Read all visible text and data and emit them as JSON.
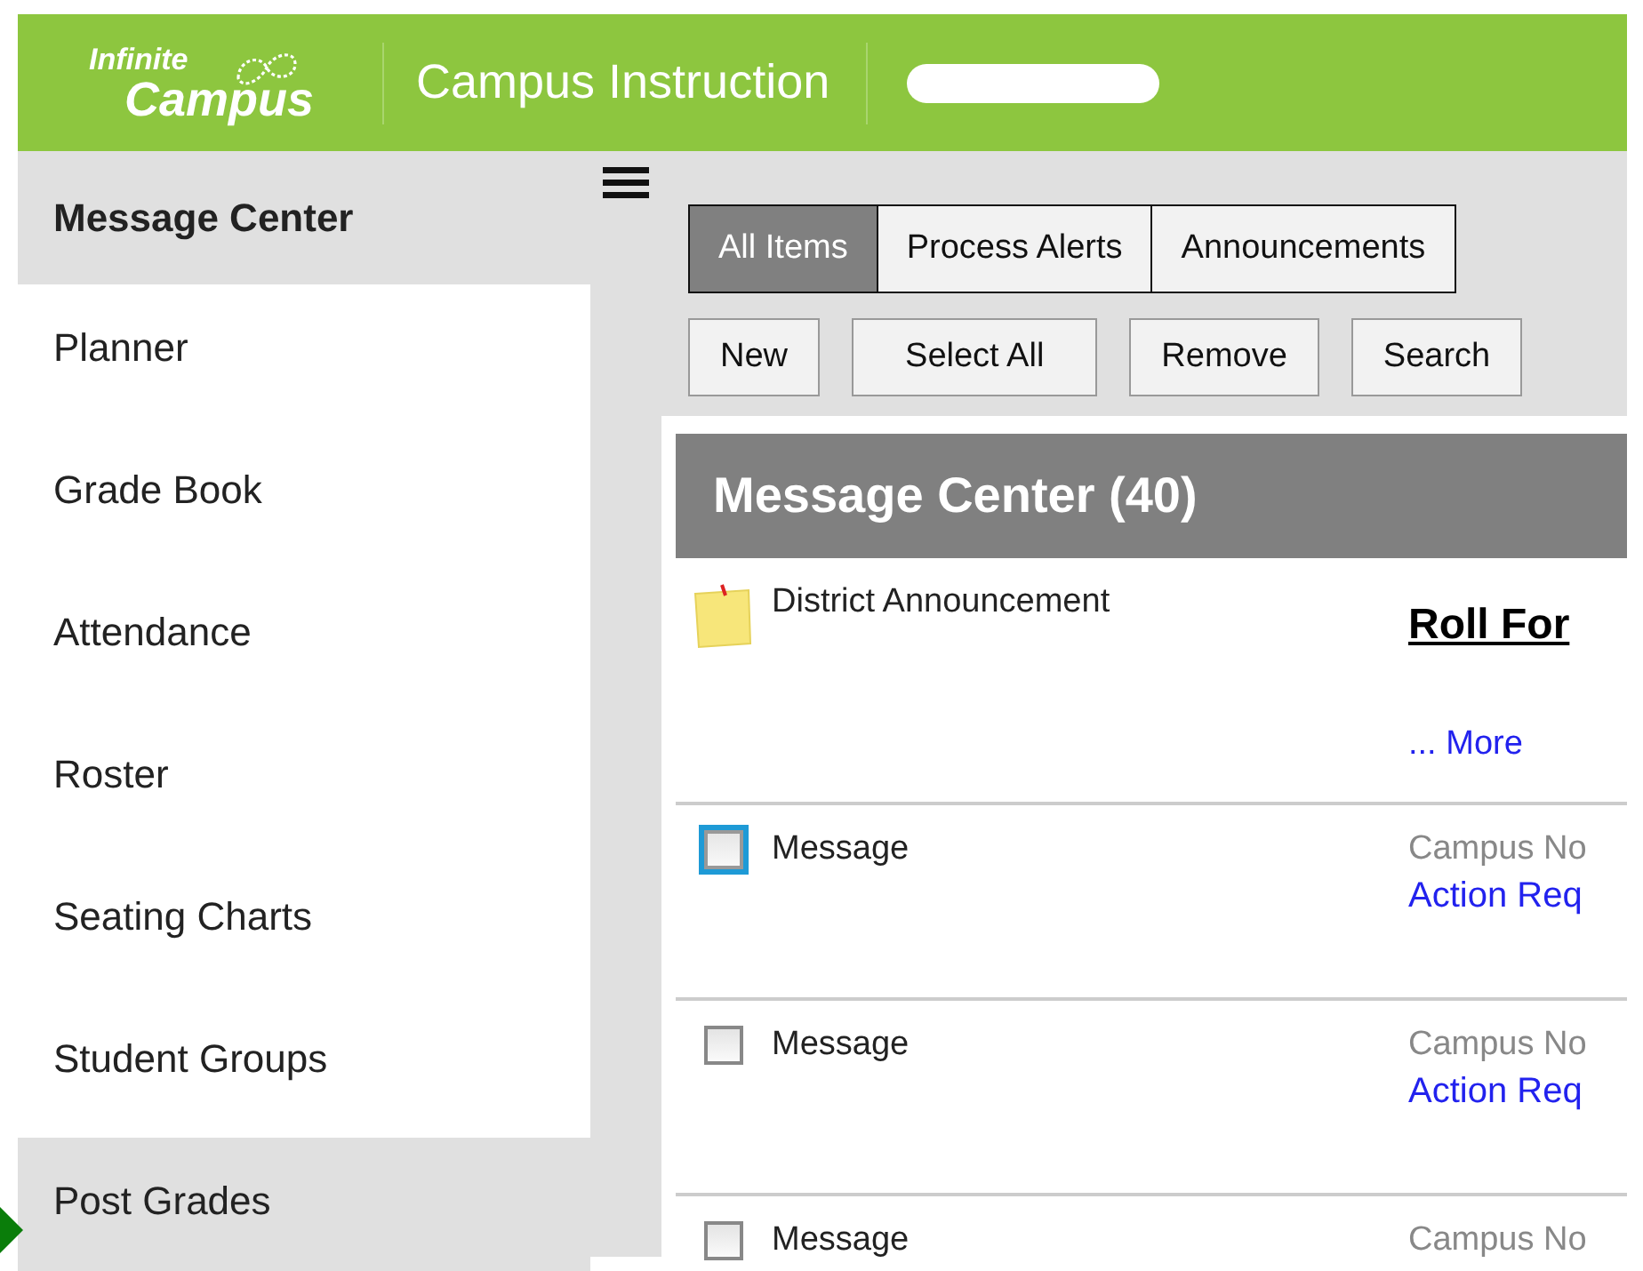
{
  "header": {
    "logo_top": "Infinite",
    "logo_bottom": "Campus",
    "app_title": "Campus Instruction"
  },
  "sidebar": {
    "title": "Message Center",
    "items": [
      {
        "label": "Planner",
        "selected": false
      },
      {
        "label": "Grade Book",
        "selected": false
      },
      {
        "label": "Attendance",
        "selected": false
      },
      {
        "label": "Roster",
        "selected": false
      },
      {
        "label": "Seating Charts",
        "selected": false
      },
      {
        "label": "Student Groups",
        "selected": false
      },
      {
        "label": "Post Grades",
        "selected": true
      }
    ]
  },
  "tabs": [
    {
      "label": "All Items",
      "selected": true
    },
    {
      "label": "Process Alerts",
      "selected": false
    },
    {
      "label": "Announcements",
      "selected": false
    }
  ],
  "buttons": [
    "New",
    "Select All",
    "Remove",
    "Search"
  ],
  "panel": {
    "title": "Message Center (40)",
    "rows": [
      {
        "kind": "announcement",
        "type": "District Announcement",
        "title": "Roll For",
        "more": "... More"
      },
      {
        "kind": "message",
        "type": "Message",
        "checked": false,
        "focused": true,
        "from": "Campus No",
        "action": "Action Req"
      },
      {
        "kind": "message",
        "type": "Message",
        "checked": false,
        "focused": false,
        "from": "Campus No",
        "action": "Action Req"
      },
      {
        "kind": "message",
        "type": "Message",
        "checked": false,
        "focused": false,
        "from": "Campus No"
      }
    ]
  }
}
